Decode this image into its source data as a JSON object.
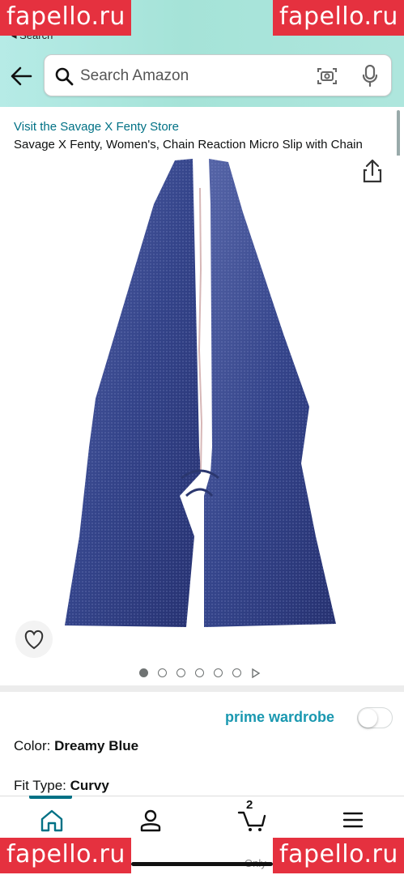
{
  "header": {
    "back_link": "◂ Search",
    "search_placeholder": "Search Amazon"
  },
  "watermarks": {
    "text": "fapello.ru"
  },
  "product": {
    "store_link": "Visit the Savage X Fenty Store",
    "title": "Savage X Fenty, Women's, Chain Reaction Micro Slip with Chain",
    "image_count": 6,
    "active_image": 1
  },
  "prime": {
    "label": "prime wardrobe",
    "toggle_on": false
  },
  "options": {
    "color_label": "Color:",
    "color_value": "Dreamy Blue",
    "fit_label": "Fit Type:",
    "fit_value": "Curvy"
  },
  "nav": {
    "cart_count": "2",
    "active_tab": "home",
    "overlay_text": "Only"
  },
  "colors": {
    "accent_link": "#007185",
    "prime": "#1a98b0",
    "header_bg": "#a5e3d8",
    "garment": "#3b4a8f"
  }
}
